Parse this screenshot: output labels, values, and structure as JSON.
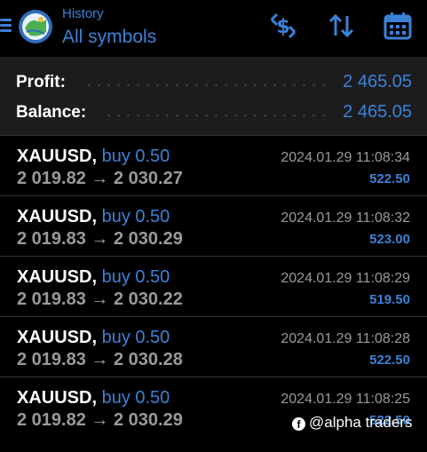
{
  "header": {
    "subtitle": "History",
    "title": "All symbols",
    "icons": [
      "menu-icon",
      "app-logo-icon",
      "currency-swap-icon",
      "sort-icon",
      "calendar-icon"
    ]
  },
  "summary": {
    "profit_label": "Profit:",
    "profit_value": "2 465.05",
    "balance_label": "Balance:",
    "balance_value": "2 465.05"
  },
  "deals": [
    {
      "symbol": "XAUUSD,",
      "type": "buy 0.50",
      "prices": "2 019.82 → 2 030.27",
      "time": "2024.01.29 11:08:34",
      "profit": "522.50"
    },
    {
      "symbol": "XAUUSD,",
      "type": "buy 0.50",
      "prices": "2 019.83 → 2 030.29",
      "time": "2024.01.29 11:08:32",
      "profit": "523.00"
    },
    {
      "symbol": "XAUUSD,",
      "type": "buy 0.50",
      "prices": "2 019.83 → 2 030.22",
      "time": "2024.01.29 11:08:29",
      "profit": "519.50"
    },
    {
      "symbol": "XAUUSD,",
      "type": "buy 0.50",
      "prices": "2 019.83 → 2 030.28",
      "time": "2024.01.29 11:08:28",
      "profit": "522.50"
    },
    {
      "symbol": "XAUUSD,",
      "type": "buy 0.50",
      "prices": "2 019.82 → 2 030.29",
      "time": "2024.01.29 11:08:25",
      "profit": "522.50"
    }
  ],
  "watermark": {
    "text": "@alpha traders"
  },
  "colors": {
    "accent": "#3b82d6",
    "background": "#000000",
    "summary_bg": "#1c1c1e",
    "muted": "#9a9a9a"
  }
}
